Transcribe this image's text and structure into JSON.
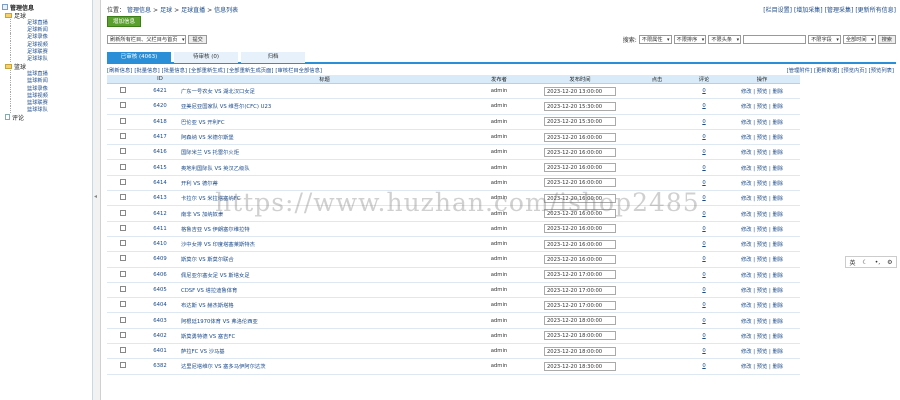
{
  "sidebar": {
    "root_label": "管理信息",
    "groups": [
      {
        "label": "足球",
        "items": [
          "足球直播",
          "足球新闻",
          "足球录像",
          "足球视频",
          "足球联赛",
          "足球球队"
        ]
      },
      {
        "label": "篮球",
        "items": [
          "篮球直播",
          "篮球新闻",
          "篮球录像",
          "篮球视频",
          "篮球联赛",
          "篮球球队"
        ]
      }
    ],
    "footer_label": "评论"
  },
  "splitter_glyph": "◂",
  "breadcrumb": {
    "prefix": "位置：",
    "items": [
      "管理信息",
      ">",
      "足球",
      ">",
      "足球直播",
      ">",
      "信息列表"
    ]
  },
  "top_links": [
    "[栏目设置]",
    "[增加采集]",
    "[管理采集]",
    "[更新所有信息]"
  ],
  "add_button": "增加信息",
  "filter": {
    "column_select": "刷新所有栏目、父栏目与首页",
    "go_button": "提交",
    "search_label": "搜索:",
    "attr_select": "不限属性",
    "order_select": "不限排序",
    "title_select": "不限头条",
    "keyword_value": "",
    "field_select": "不限字段",
    "time_select": "全部时间",
    "search_button": "搜索"
  },
  "tabs": [
    "已审核 (4063)",
    "待审核 (0)",
    "归档"
  ],
  "actions_left": [
    "[刷新信息]",
    "[批量信息]",
    "[批量信息]",
    "[全部重新生成]",
    "[全部重新生成页面]",
    "[审核栏目全部信息]"
  ],
  "actions_right": [
    "[管理附件]",
    "[更新数据]",
    "[预览内页]",
    "[预览列表]"
  ],
  "table": {
    "headers": [
      "",
      "ID",
      "标题",
      "发布者",
      "发布时间",
      "点击",
      "评论",
      "操作"
    ],
    "rows": [
      {
        "id": "6421",
        "title": "广东一号农女 VS 湖北汉口女足",
        "author": "admin",
        "time": "2023-12-20 13:00:00",
        "clicks": "",
        "comments": "0",
        "ops": "修改 | 预览 | 删除"
      },
      {
        "id": "6420",
        "title": "亚美尼亚国家队 VS 维吾尔(CFC) U23",
        "author": "admin",
        "time": "2023-12-20 15:30:00",
        "clicks": "",
        "comments": "0",
        "ops": "修改 | 预览 | 删除"
      },
      {
        "id": "6418",
        "title": "巴伦亚 VS 开利FC",
        "author": "admin",
        "time": "2023-12-20 15:30:00",
        "clicks": "",
        "comments": "0",
        "ops": "修改 | 预览 | 删除"
      },
      {
        "id": "6417",
        "title": "阿森纳 VS 米德尔斯堡",
        "author": "admin",
        "time": "2023-12-20 16:00:00",
        "clicks": "",
        "comments": "0",
        "ops": "修改 | 预览 | 删除"
      },
      {
        "id": "6416",
        "title": "国际米兰 VS 托雷尔火炬",
        "author": "admin",
        "time": "2023-12-20 16:00:00",
        "clicks": "",
        "comments": "0",
        "ops": "修改 | 预览 | 删除"
      },
      {
        "id": "6415",
        "title": "奥地利国际队 VS 英汉乙级队",
        "author": "admin",
        "time": "2023-12-20 16:00:00",
        "clicks": "",
        "comments": "0",
        "ops": "修改 | 预览 | 删除"
      },
      {
        "id": "6414",
        "title": "开利 VS 德尔蒂",
        "author": "admin",
        "time": "2023-12-20 16:00:00",
        "clicks": "",
        "comments": "0",
        "ops": "修改 | 预览 | 删除"
      },
      {
        "id": "6413",
        "title": "卡拉尔 VS 米拉塔塞纳FC",
        "author": "admin",
        "time": "2023-12-20 16:00:00",
        "clicks": "",
        "comments": "0",
        "ops": "修改 | 预览 | 删除"
      },
      {
        "id": "6412",
        "title": "南非 VS 加纳奴隶",
        "author": "admin",
        "time": "2023-12-20 16:00:00",
        "clicks": "",
        "comments": "0",
        "ops": "修改 | 预览 | 删除"
      },
      {
        "id": "6411",
        "title": "格鲁吉亚 VS 伊朗塞尔维拉特",
        "author": "admin",
        "time": "2023-12-20 16:00:00",
        "clicks": "",
        "comments": "0",
        "ops": "修改 | 预览 | 删除"
      },
      {
        "id": "6410",
        "title": "沙中女排 VS 印度塔塞莱斯特杰",
        "author": "admin",
        "time": "2023-12-20 16:00:00",
        "clicks": "",
        "comments": "0",
        "ops": "修改 | 预览 | 删除"
      },
      {
        "id": "6409",
        "title": "斯莫尔 VS 斯莫尔联合",
        "author": "admin",
        "time": "2023-12-20 16:00:00",
        "clicks": "",
        "comments": "0",
        "ops": "修改 | 预览 | 删除"
      },
      {
        "id": "6406",
        "title": "佩尼亚尔塞女足 VS 斯塔女足",
        "author": "admin",
        "time": "2023-12-20 17:00:00",
        "clicks": "",
        "comments": "0",
        "ops": "修改 | 预览 | 删除"
      },
      {
        "id": "6405",
        "title": "CDSF VS 塔拉迪鲁体育",
        "author": "admin",
        "time": "2023-12-20 17:00:00",
        "clicks": "",
        "comments": "0",
        "ops": "修改 | 预览 | 删除"
      },
      {
        "id": "6404",
        "title": "布达斯 VS 赫杰斯塔格",
        "author": "admin",
        "time": "2023-12-20 17:00:00",
        "clicks": "",
        "comments": "0",
        "ops": "修改 | 预览 | 删除"
      },
      {
        "id": "6403",
        "title": "阿根廷1970体育 VS 弗洛伦西亚",
        "author": "admin",
        "time": "2023-12-20 18:00:00",
        "clicks": "",
        "comments": "0",
        "ops": "修改 | 预览 | 删除"
      },
      {
        "id": "6402",
        "title": "斯莫勇特德 VS 塞吉FC",
        "author": "admin",
        "time": "2023-12-20 18:00:00",
        "clicks": "",
        "comments": "0",
        "ops": "修改 | 预览 | 删除"
      },
      {
        "id": "6401",
        "title": "萨拉FC VS 沙马基",
        "author": "admin",
        "time": "2023-12-20 18:00:00",
        "clicks": "",
        "comments": "0",
        "ops": "修改 | 预览 | 删除"
      },
      {
        "id": "6382",
        "title": "达里尼塔维尔 VS 塞多马伊阿尔达茨",
        "author": "admin",
        "time": "2023-12-20 18:30:00",
        "clicks": "",
        "comments": "0",
        "ops": "修改 | 预览 | 删除"
      }
    ]
  },
  "watermark": "https://www.huzhan.com/ishop2485",
  "ime_bar": {
    "lang": "英",
    "moon": "☾",
    "dots": "•,",
    "gear": "⚙"
  }
}
